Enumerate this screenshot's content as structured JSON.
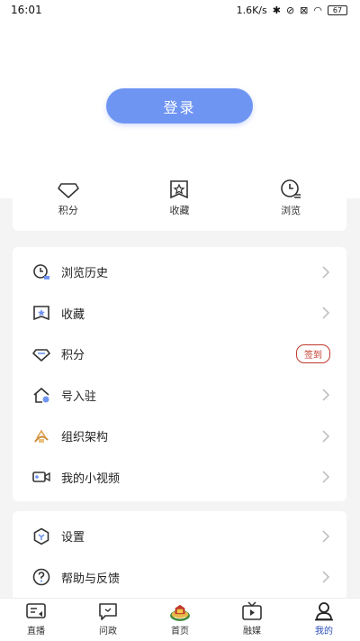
{
  "status": {
    "time": "16:01",
    "speed": "1.6K/s",
    "battery": "67"
  },
  "login_label": "登录",
  "quick": [
    {
      "icon": "diamond-icon",
      "label": "积分"
    },
    {
      "icon": "star-bookmark-icon",
      "label": "收藏"
    },
    {
      "icon": "clock-history-icon",
      "label": "浏览"
    }
  ],
  "menu_a": [
    {
      "icon": "clock-history-icon",
      "label": "浏览历史"
    },
    {
      "icon": "star-bookmark-icon",
      "label": "收藏"
    },
    {
      "icon": "diamond-icon",
      "label": "积分",
      "badge": "签到"
    },
    {
      "icon": "house-enter-icon",
      "label": "号入驻"
    },
    {
      "icon": "org-structure-icon",
      "label": "组织架构"
    },
    {
      "icon": "video-camera-icon",
      "label": "我的小视频"
    }
  ],
  "menu_b": [
    {
      "icon": "settings-hex-icon",
      "label": "设置"
    },
    {
      "icon": "help-icon",
      "label": "帮助与反馈"
    }
  ],
  "tabs": [
    {
      "icon": "live-tv-icon",
      "label": "直播"
    },
    {
      "icon": "message-icon",
      "label": "问政"
    },
    {
      "icon": "home-emblem-icon",
      "label": "首页"
    },
    {
      "icon": "media-tv-icon",
      "label": "融媒"
    },
    {
      "icon": "profile-icon",
      "label": "我的",
      "active": true
    }
  ],
  "colors": {
    "accent": "#6f95f3",
    "badge_red": "#c0392b",
    "active_tab": "#2c4db8"
  }
}
